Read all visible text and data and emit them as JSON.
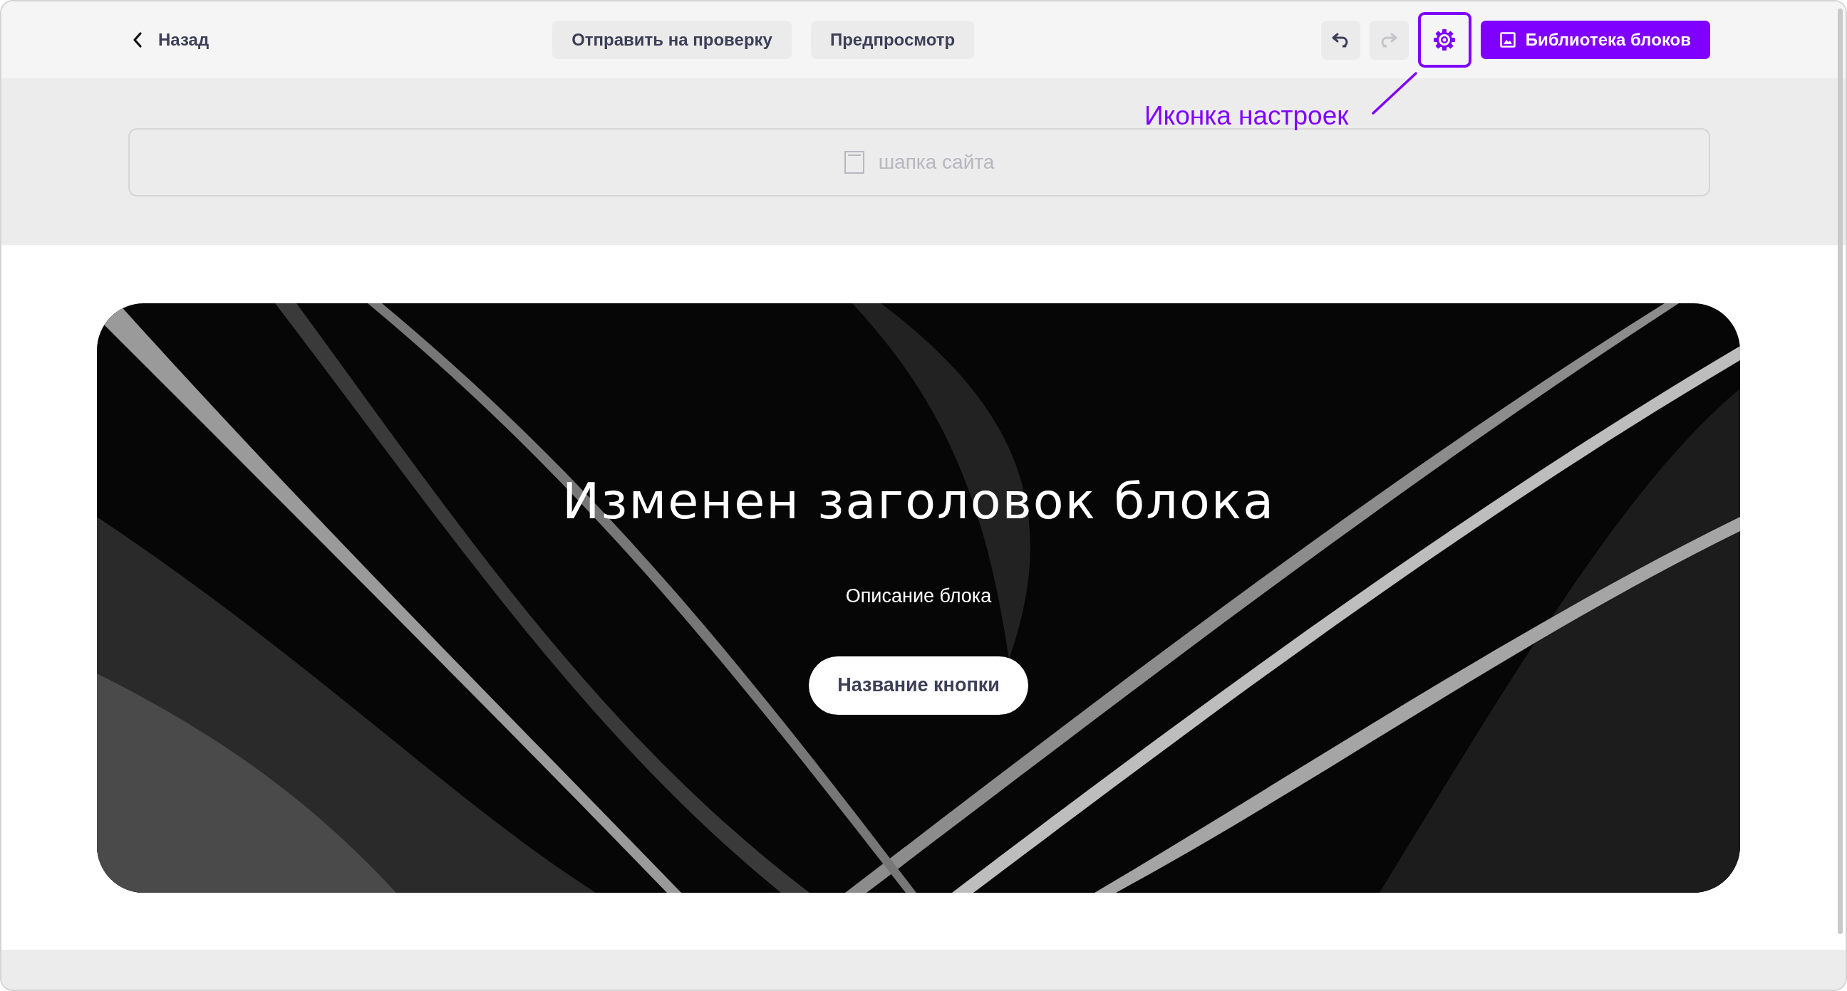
{
  "toolbar": {
    "back": {
      "label": "Назад"
    },
    "buttons": [
      {
        "label": "Отправить на проверку"
      },
      {
        "label": "Предпросмотр"
      }
    ],
    "history": [
      {
        "kind": "undo",
        "disabled": false
      },
      {
        "kind": "redo",
        "disabled": true
      }
    ],
    "settings": {
      "highlighted": true
    },
    "library_button": {
      "label": "Библиотека блоков"
    }
  },
  "annotation": {
    "text": "Иконка настроек"
  },
  "header_placeholder": {
    "label": "шапка сайта"
  },
  "hero": {
    "title": "Изменен заголовок блока",
    "description": "Описание блока",
    "button": {
      "label": "Название кнопки"
    }
  }
}
